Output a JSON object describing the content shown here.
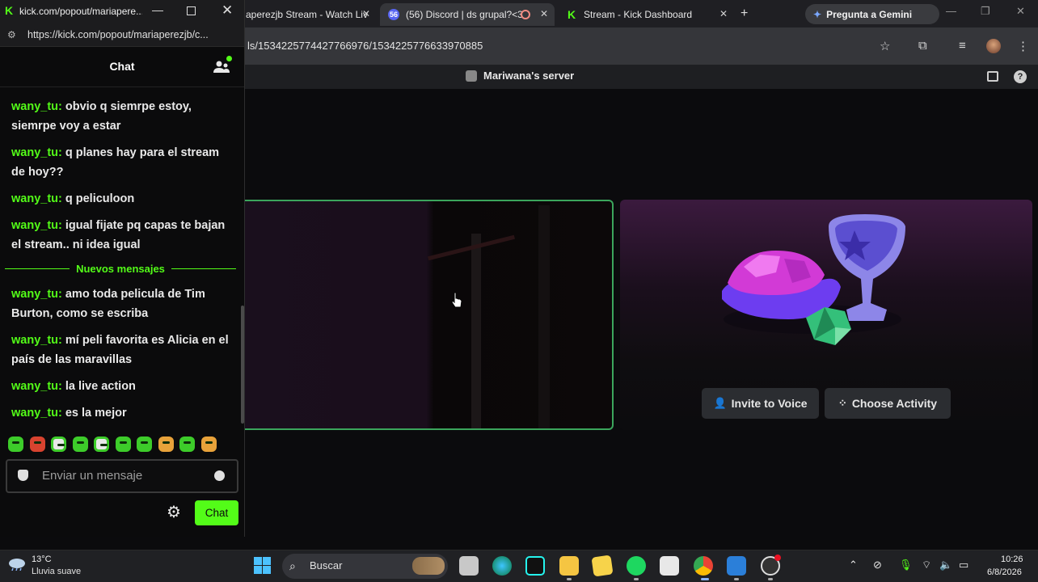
{
  "browser": {
    "tabs": [
      {
        "title": "aperezjb Stream - Watch Liv",
        "favicon": "kick-icon"
      },
      {
        "title": "(56) Discord | ds grupal?<3",
        "favicon": "discord-icon",
        "badge": "56"
      },
      {
        "title": "Stream - Kick Dashboard",
        "favicon": "kick-icon"
      }
    ],
    "gemini_label": "Pregunta a Gemini",
    "url": "ls/1534225774427766976/1534225776633970885"
  },
  "discord": {
    "server_name": "Mariwana's server",
    "invite_label": "Invite to Voice",
    "choose_label": "Choose Activity"
  },
  "popout": {
    "window_title": "kick.com/popout/mariapere...",
    "url": "https://kick.com/popout/mariaperezjb/c...",
    "chat_title": "Chat",
    "messages_before": [
      {
        "user": "wany_tu:",
        "text": " obvio q siemrpe estoy, siemrpe voy a estar"
      },
      {
        "user": "wany_tu:",
        "text": " q planes hay para el stream de hoy??"
      },
      {
        "user": "wany_tu:",
        "text": " q peliculoon"
      },
      {
        "user": "wany_tu:",
        "text": " igual fijate pq capas te bajan el stream.. ni idea igual"
      }
    ],
    "new_messages_label": "Nuevos mensajes",
    "messages_after": [
      {
        "user": "wany_tu:",
        "text": " amo toda pelicula de Tim Burton, como se escriba"
      },
      {
        "user": "wany_tu:",
        "text": " mí peli favorita es Alicia en el país de las maravillas"
      },
      {
        "user": "wany_tu:",
        "text": " la live action"
      },
      {
        "user": "wany_tu:",
        "text": " es la mejor"
      }
    ],
    "input_placeholder": "Enviar un mensaje",
    "chat_button": "Chat",
    "accent": "#53fc18"
  },
  "taskbar": {
    "temperature": "13°C",
    "condition": "Lluvia suave",
    "search_placeholder": "Buscar",
    "time": "10:26",
    "date": "6/8/2026"
  }
}
